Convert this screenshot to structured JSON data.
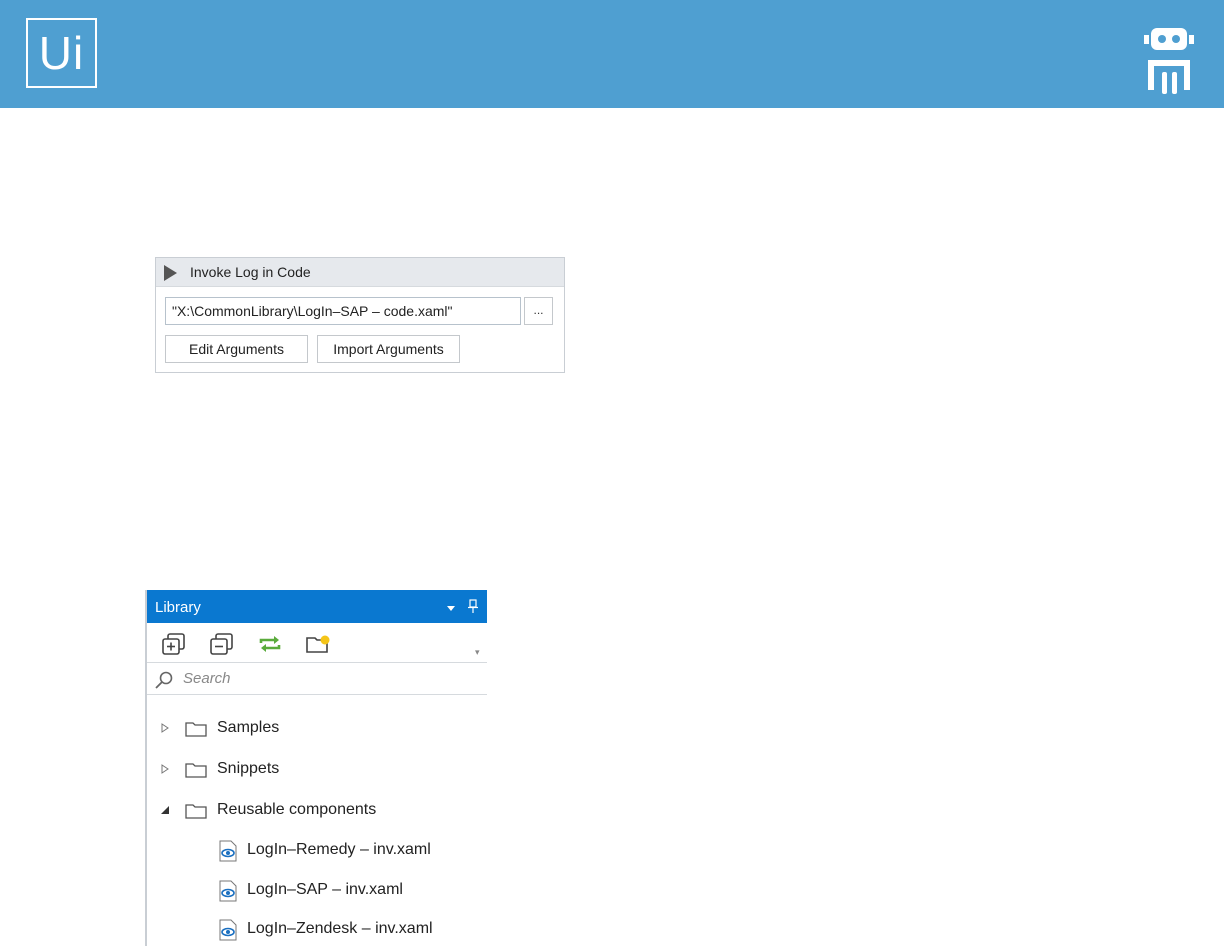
{
  "banner": {
    "logo_text": "Ui",
    "color": "#4f9fd1"
  },
  "invoke_activity": {
    "title": "Invoke Log in Code",
    "file_path": "\"X:\\CommonLibrary\\LogIn–SAP – code.xaml\"",
    "browse_label": "...",
    "edit_arguments_label": "Edit Arguments",
    "import_arguments_label": "Import Arguments"
  },
  "library": {
    "title": "Library",
    "title_color": "#0a78d0",
    "search_placeholder": "Search",
    "toolbar_icons": [
      "expand-all-icon",
      "collapse-all-icon",
      "refresh-icon",
      "new-folder-icon"
    ],
    "tree": [
      {
        "label": "Samples",
        "expanded": false
      },
      {
        "label": "Snippets",
        "expanded": false
      },
      {
        "label": "Reusable components",
        "expanded": true,
        "children": [
          {
            "label": "LogIn–Remedy – inv.xaml"
          },
          {
            "label": "LogIn–SAP – inv.xaml"
          },
          {
            "label": "LogIn–Zendesk – inv.xaml"
          }
        ]
      }
    ]
  }
}
